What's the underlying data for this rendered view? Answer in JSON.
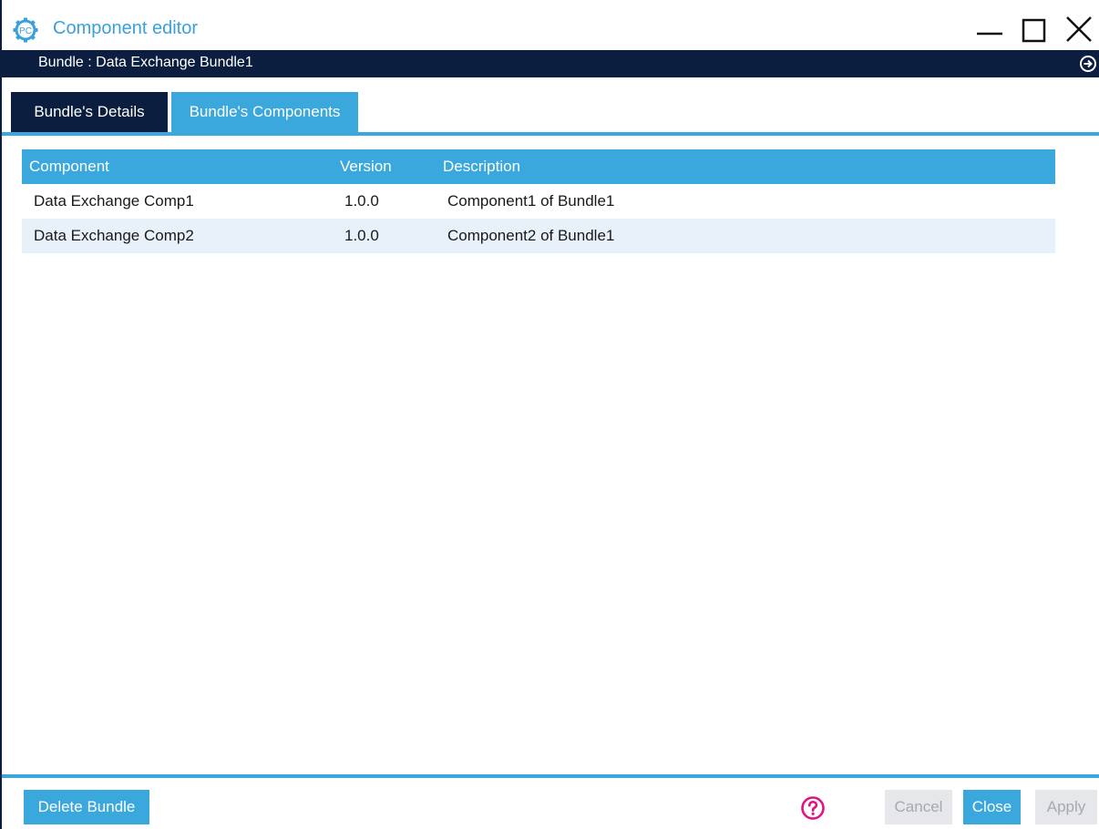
{
  "window": {
    "title": "Component editor",
    "logo_text": "PC",
    "logo_icon": "gear-logo-icon",
    "controls": [
      "minimize-icon",
      "maximize-icon",
      "close-icon"
    ]
  },
  "bundle_bar": {
    "label": "Bundle : Data Exchange Bundle1",
    "icon": "expand-arrow-icon"
  },
  "tabs": [
    {
      "label": "Bundle's Details"
    },
    {
      "label": "Bundle's Components",
      "active": true
    }
  ],
  "table": {
    "columns": [
      "Component",
      "Version",
      "Description"
    ],
    "rows": [
      {
        "component": "Data Exchange Comp1",
        "version": "1.0.0",
        "description": "Component1 of Bundle1"
      },
      {
        "component": "Data Exchange Comp2",
        "version": "1.0.0",
        "description": "Component2 of Bundle1"
      }
    ]
  },
  "footer": {
    "delete_label": "Delete Bundle",
    "help_icon": "help-icon",
    "cancel_label": "Cancel",
    "close_label": "Close",
    "apply_label": "Apply"
  },
  "colors": {
    "navy": "#0b1e3f",
    "accent": "#3aa8dc",
    "row_alt": "#e8f1f9",
    "help": "#e0137f",
    "disabled": "#e6e7ea"
  }
}
